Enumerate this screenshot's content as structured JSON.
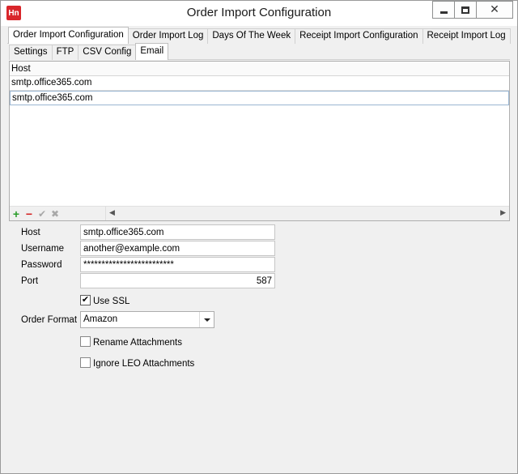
{
  "window": {
    "app_icon_text": "Hn",
    "title": "Order Import Configuration"
  },
  "top_tabs": [
    {
      "label": "Order Import Configuration",
      "active": true
    },
    {
      "label": "Order Import Log",
      "active": false
    },
    {
      "label": "Days Of The Week",
      "active": false
    },
    {
      "label": "Receipt Import Configuration",
      "active": false
    },
    {
      "label": "Receipt Import Log",
      "active": false
    }
  ],
  "sub_tabs": [
    {
      "label": "Settings",
      "active": false
    },
    {
      "label": "FTP",
      "active": false
    },
    {
      "label": "CSV Config",
      "active": false
    },
    {
      "label": "Email",
      "active": true
    }
  ],
  "grid": {
    "header": "Host",
    "rows": [
      "smtp.office365.com",
      "smtp.office365.com"
    ],
    "nav_icons": [
      "plus-icon",
      "minus-icon",
      "check-icon",
      "x-icon"
    ]
  },
  "form": {
    "host_label": "Host",
    "host_value": "smtp.office365.com",
    "username_label": "Username",
    "username_value": "another@example.com",
    "password_label": "Password",
    "password_value": "*************************",
    "port_label": "Port",
    "port_value": "587",
    "use_ssl_label": "Use SSL",
    "use_ssl_checked": true,
    "order_format_label": "Order Format",
    "order_format_value": "Amazon",
    "rename_attachments_label": "Rename Attachments",
    "rename_attachments_checked": false,
    "ignore_leo_label": "Ignore LEO Attachments",
    "ignore_leo_checked": false
  },
  "colors": {
    "app_icon": "#d9262b",
    "add_button": "#2a9d2a",
    "delete_button": "#d32020"
  }
}
